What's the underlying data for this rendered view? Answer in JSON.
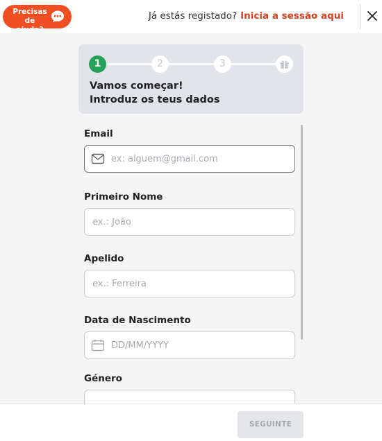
{
  "header": {
    "help_label": "Precisas de ajuda?",
    "help_icon": "chat-bubble-icon",
    "login_question": "Já estás registado?",
    "login_link": "Inicia a sessão aqui",
    "close_icon": "close-icon"
  },
  "stepper": {
    "steps": [
      "1",
      "2",
      "3"
    ],
    "final_step_icon": "gift-icon",
    "current_step": 1,
    "title_line1": "Vamos começar!",
    "title_line2": "Introduz os teus dados"
  },
  "form": {
    "email": {
      "label": "Email",
      "placeholder": "ex: alguem@gmail.com",
      "icon": "envelope-icon"
    },
    "first_name": {
      "label": "Primeiro Nome",
      "placeholder": "ex.: João"
    },
    "last_name": {
      "label": "Apelido",
      "placeholder": "ex.: Ferreira"
    },
    "birth_date": {
      "label": "Data de Nascimento",
      "placeholder": "DD/MM/YYYY",
      "icon": "calendar-icon"
    },
    "gender": {
      "label": "Género"
    }
  },
  "footer": {
    "next_label": "SEGUINTE"
  },
  "colors": {
    "brand": "#f04e23",
    "link": "#d8401e",
    "step_active": "#27a05a",
    "stepper_bg": "#e1e4e8"
  }
}
